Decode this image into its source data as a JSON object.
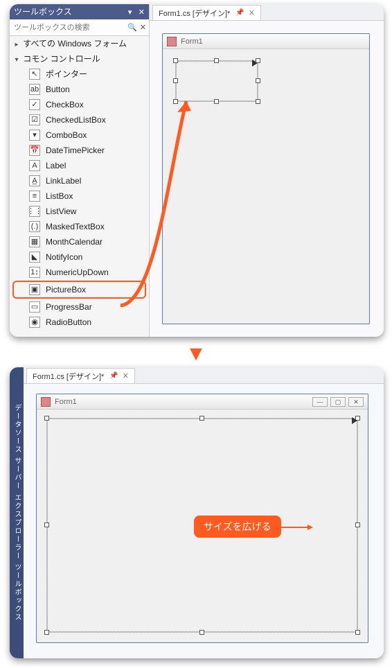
{
  "accent": "#ff5a1f",
  "toolbox": {
    "title": "ツールボックス",
    "search_placeholder": "ツールボックスの検索",
    "groups": [
      {
        "label": "すべての Windows フォーム",
        "expanded": false
      },
      {
        "label": "コモン コントロール",
        "expanded": true
      }
    ],
    "items": [
      {
        "icon": "↖",
        "label": "ポインター"
      },
      {
        "icon": "ab",
        "label": "Button"
      },
      {
        "icon": "✓",
        "label": "CheckBox"
      },
      {
        "icon": "☑",
        "label": "CheckedListBox"
      },
      {
        "icon": "▾",
        "label": "ComboBox"
      },
      {
        "icon": "📅",
        "label": "DateTimePicker"
      },
      {
        "icon": "A",
        "label": "Label"
      },
      {
        "icon": "A̲",
        "label": "LinkLabel"
      },
      {
        "icon": "≡",
        "label": "ListBox"
      },
      {
        "icon": "⋮⋮",
        "label": "ListView"
      },
      {
        "icon": "(.)",
        "label": "MaskedTextBox"
      },
      {
        "icon": "▦",
        "label": "MonthCalendar"
      },
      {
        "icon": "◣",
        "label": "NotifyIcon"
      },
      {
        "icon": "1↕",
        "label": "NumericUpDown"
      },
      {
        "icon": "▣",
        "label": "PictureBox",
        "highlight": true
      },
      {
        "icon": "▭",
        "label": "ProgressBar"
      },
      {
        "icon": "◉",
        "label": "RadioButton"
      }
    ]
  },
  "tab": {
    "label": "Form1.cs [デザイン]*"
  },
  "form": {
    "title": "Form1"
  },
  "side_strip": "データソース  サーバー エクスプローラー  ツールボックス",
  "callout": "サイズを広げる"
}
